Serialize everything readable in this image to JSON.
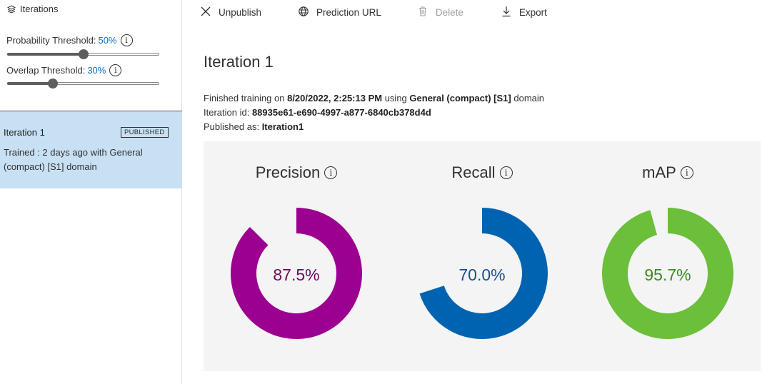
{
  "sidebar": {
    "header_label": "Iterations",
    "probability_label": "Probability Threshold:",
    "probability_value": "50%",
    "probability_level": 0.5,
    "overlap_label": "Overlap Threshold:",
    "overlap_value": "30%",
    "overlap_level": 0.3,
    "info_glyph": "i",
    "iteration": {
      "name": "Iteration 1",
      "badge": "PUBLISHED",
      "description": "Trained : 2 days ago with General (compact) [S1] domain"
    }
  },
  "toolbar": {
    "unpublish_label": "Unpublish",
    "prediction_url_label": "Prediction URL",
    "delete_label": "Delete",
    "export_label": "Export"
  },
  "main": {
    "title": "Iteration 1",
    "finished_prefix": "Finished training on",
    "finished_date": "8/20/2022, 2:25:13 PM",
    "using_word": "using",
    "domain_name": "General (compact) [S1]",
    "domain_suffix": "domain",
    "iteration_id_label": "Iteration id:",
    "iteration_id": "88935e61-e690-4997-a877-6840cb378d4d",
    "published_as_label": "Published as:",
    "published_as": "Iteration1"
  },
  "metrics": [
    {
      "name": "Precision",
      "display": "87.5%",
      "value": 87.5,
      "color": "#9c0090",
      "text_color": "#6b0a5f"
    },
    {
      "name": "Recall",
      "display": "70.0%",
      "value": 70.0,
      "color": "#0063b1",
      "text_color": "#1b4f8f"
    },
    {
      "name": "mAP",
      "display": "95.7%",
      "value": 95.7,
      "color": "#6bbf3a",
      "text_color": "#3d8a1e"
    }
  ]
}
